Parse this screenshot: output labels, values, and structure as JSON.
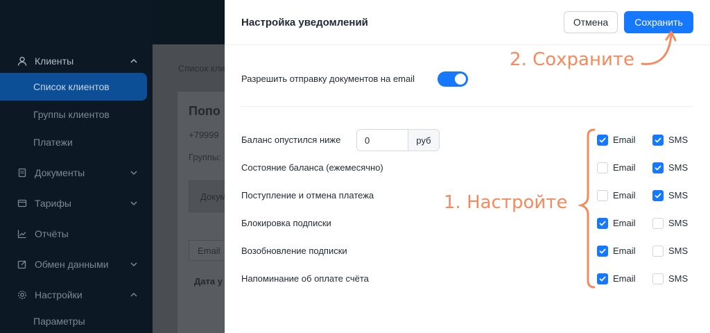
{
  "sidebar": {
    "clients": "Клиенты",
    "client_list": "Список клиентов",
    "client_groups": "Группы клиентов",
    "payments": "Платежи",
    "documents": "Документы",
    "tariffs": "Тарифы",
    "reports": "Отчёты",
    "data_exchange": "Обмен данными",
    "settings": "Настройки",
    "parameters": "Параметры"
  },
  "background": {
    "breadcrumb": "Список кли",
    "client_name": "Попо",
    "phone": "+79999",
    "groups": "Группы:",
    "documents_tab": "Докум",
    "email_filter": "Email",
    "date_header": "Дата у"
  },
  "modal": {
    "title": "Настройка уведомлений",
    "cancel": "Отмена",
    "save": "Сохранить",
    "allow_email_docs": "Разрешить отправку документов на email",
    "allow_email_docs_enabled": true,
    "balance_value": "0",
    "balance_unit": "руб",
    "email_label": "Email",
    "sms_label": "SMS",
    "rows": [
      {
        "label": "Баланс опустился ниже",
        "email": true,
        "sms": true
      },
      {
        "label": "Состояние баланса (ежемесячно)",
        "email": false,
        "sms": true
      },
      {
        "label": "Поступление и отмена платежа",
        "email": false,
        "sms": true
      },
      {
        "label": "Блокировка подписки",
        "email": true,
        "sms": false
      },
      {
        "label": "Возобновление подписки",
        "email": true,
        "sms": false
      },
      {
        "label": "Напоминание об оплате счёта",
        "email": true,
        "sms": false
      }
    ]
  },
  "annotations": {
    "step1": "1. Настройте",
    "step2": "2. Сохраните",
    "color": "#f58a5c"
  },
  "colors": {
    "primary": "#1677ff",
    "sidebar_bg": "#0c1824"
  }
}
